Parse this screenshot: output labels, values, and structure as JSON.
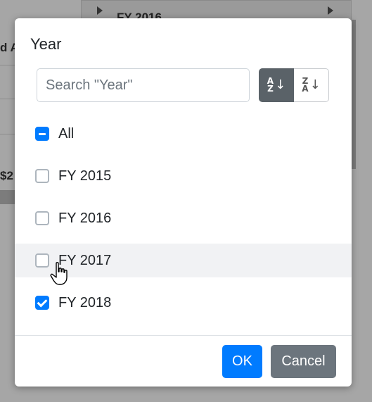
{
  "background": {
    "header_label": "FY 2016",
    "left_text_1": "d A",
    "left_text_2": "$2"
  },
  "dialog": {
    "title": "Year",
    "search": {
      "placeholder": "Search \"Year\"",
      "value": ""
    },
    "sort_asc": {
      "top": "A",
      "bottom": "Z",
      "active": true
    },
    "sort_desc": {
      "top": "Z",
      "bottom": "A",
      "active": false
    },
    "items": [
      {
        "label": "All",
        "state": "indeterminate"
      },
      {
        "label": "FY 2015",
        "state": "unchecked"
      },
      {
        "label": "FY 2016",
        "state": "unchecked"
      },
      {
        "label": "FY 2017",
        "state": "unchecked",
        "hovered": true
      },
      {
        "label": "FY 2018",
        "state": "checked"
      }
    ],
    "ok_label": "OK",
    "cancel_label": "Cancel"
  },
  "colors": {
    "primary": "#007bff",
    "secondary": "#6c757d",
    "sort_active": "#5a6268",
    "hover_row": "#f1f2f4"
  }
}
